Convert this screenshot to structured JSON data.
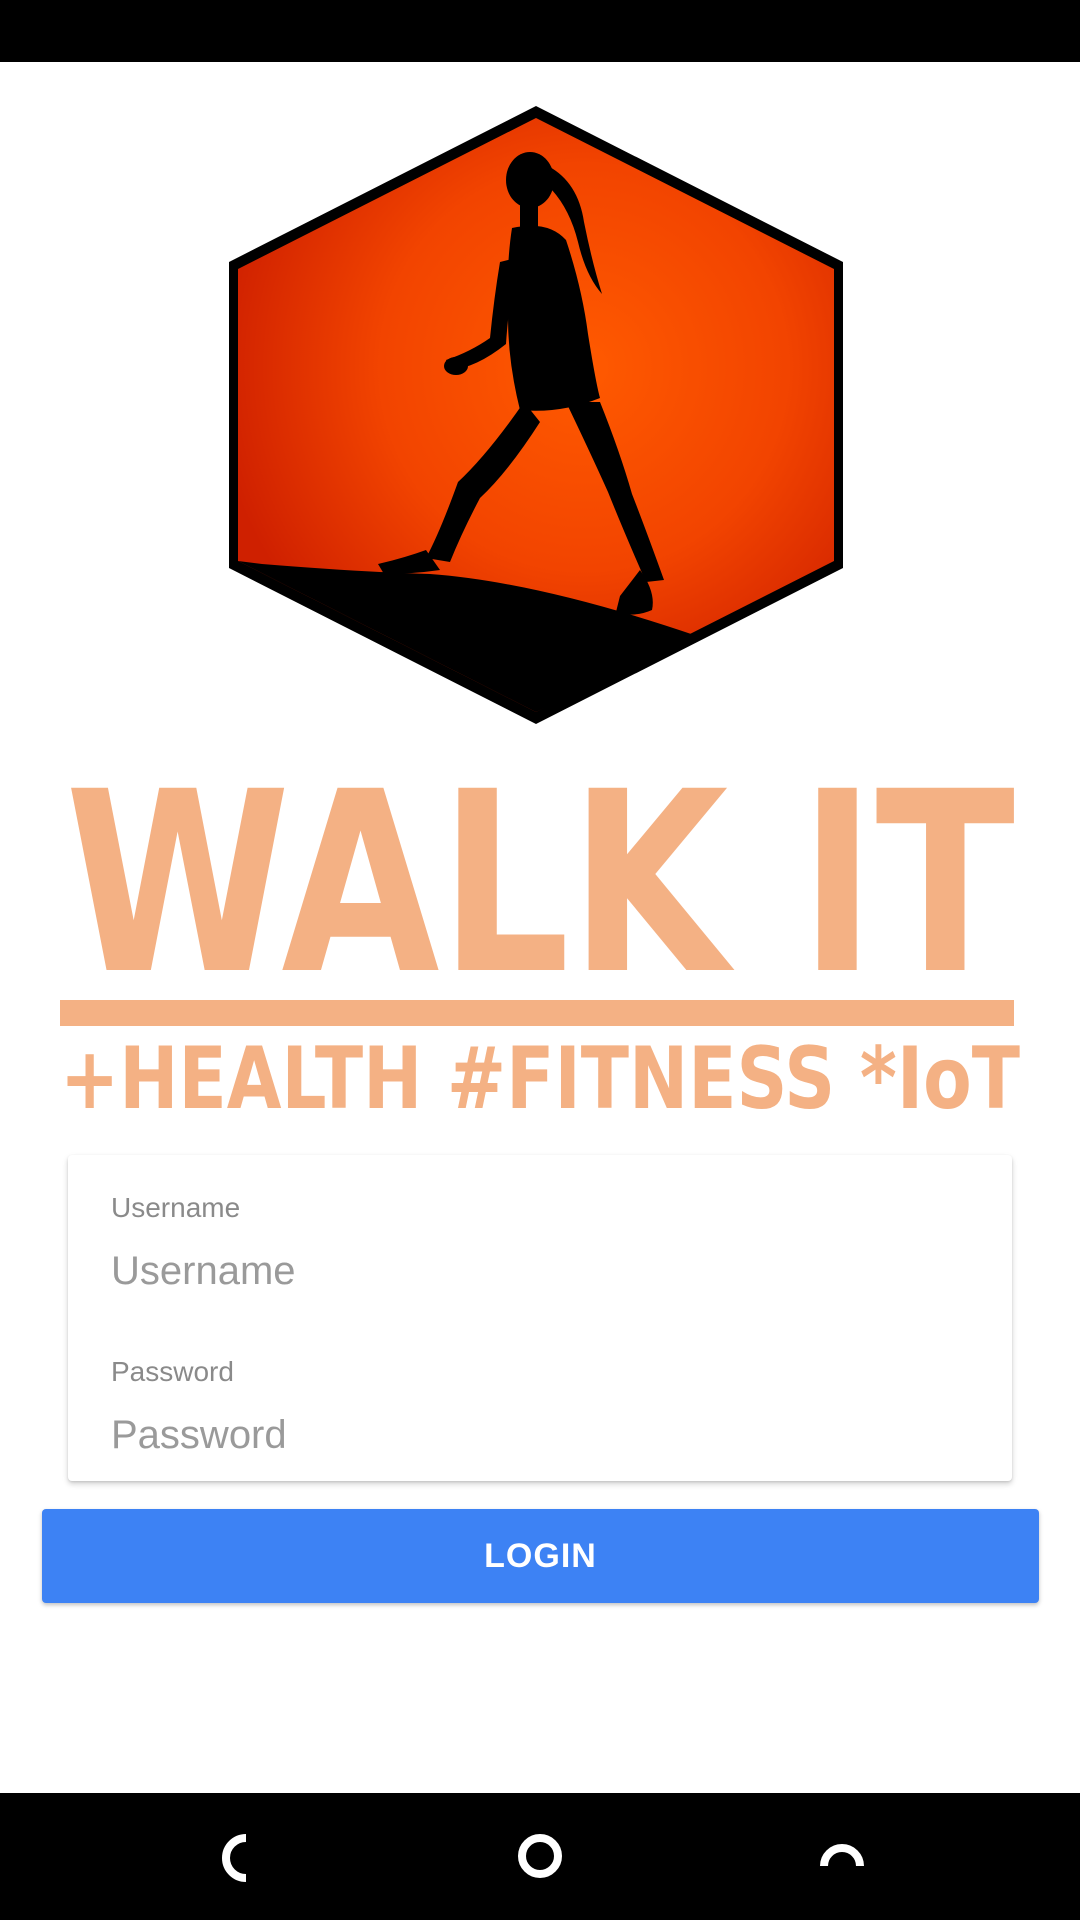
{
  "logo": {
    "title": "WALK IT",
    "tagline": "+HEALTH #FITNESS *IoT",
    "icon": "walking-woman-hexagon-logo",
    "colors": {
      "hexagon": "#f04a00",
      "wordmark": "#f4b184"
    }
  },
  "form": {
    "username": {
      "label": "Username",
      "placeholder": "Username",
      "value": ""
    },
    "password": {
      "label": "Password",
      "placeholder": "Password",
      "value": ""
    },
    "login_label": "LOGIN"
  },
  "colors": {
    "primary": "#3d82f4",
    "label": "#8a8a8a"
  },
  "navigation": {
    "back_icon": "back-icon",
    "home_icon": "home-icon",
    "recents_icon": "recents-icon"
  }
}
